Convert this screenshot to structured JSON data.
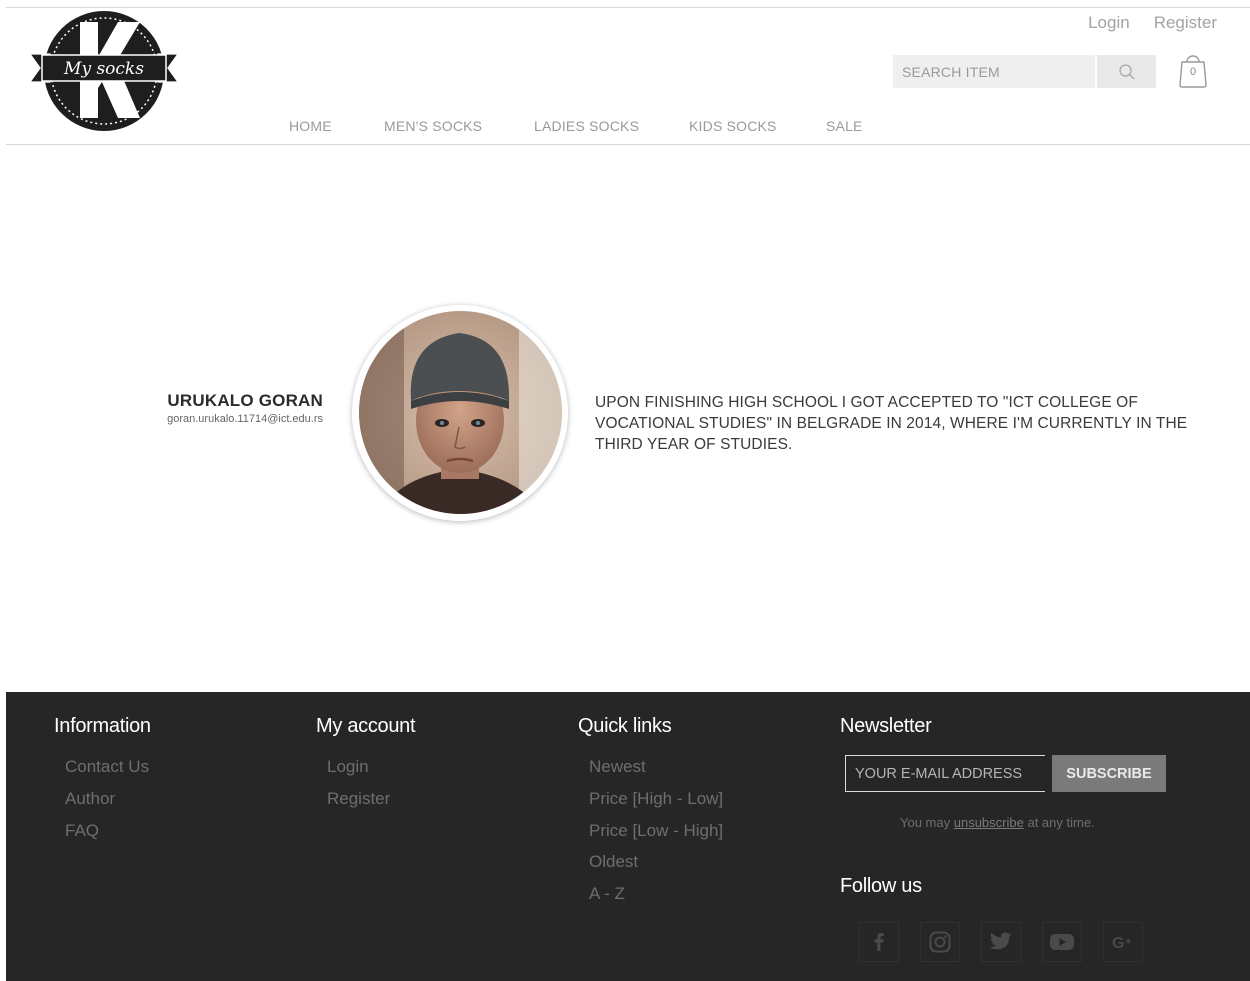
{
  "header": {
    "brand_text": "My socks",
    "login": "Login",
    "register": "Register",
    "search_placeholder": "SEARCH ITEM",
    "cart_count": "0"
  },
  "nav": [
    {
      "label": "HOME"
    },
    {
      "label": "MEN'S SOCKS"
    },
    {
      "label": "LADIES SOCKS"
    },
    {
      "label": "KIDS SOCKS"
    },
    {
      "label": "SALE"
    }
  ],
  "author": {
    "name": "URUKALO GORAN",
    "email": "goran.urukalo.11714@ict.edu.rs",
    "bio": "UPON FINISHING HIGH SCHOOL I GOT ACCEPTED TO \"ICT COLLEGE OF VOCATIONAL STUDIES\" IN BELGRADE IN 2014, WHERE I'M CURRENTLY IN THE THIRD YEAR OF STUDIES."
  },
  "footer": {
    "information": {
      "title": "Information",
      "links": [
        "Contact Us",
        "Author",
        "FAQ"
      ]
    },
    "account": {
      "title": "My account",
      "links": [
        "Login",
        "Register"
      ]
    },
    "quick_links": {
      "title": "Quick links",
      "links": [
        "Newest",
        "Price [High - Low]",
        "Price [Low - High]",
        "Oldest",
        "A - Z"
      ]
    },
    "newsletter": {
      "title": "Newsletter",
      "email_placeholder": "YOUR E-MAIL ADDRESS",
      "subscribe": "SUBSCRIBE",
      "note_before": "You may",
      "note_link": "unsubscribe",
      "note_after": "at any time."
    },
    "follow": {
      "title": "Follow us",
      "icons": [
        "facebook-icon",
        "instagram-icon",
        "twitter-icon",
        "youtube-icon",
        "google-plus-icon"
      ]
    }
  },
  "colors": {
    "footer_bg": "#262626",
    "muted_text": "#9a9a9a",
    "subscribe_bg": "#7a7a7a"
  }
}
